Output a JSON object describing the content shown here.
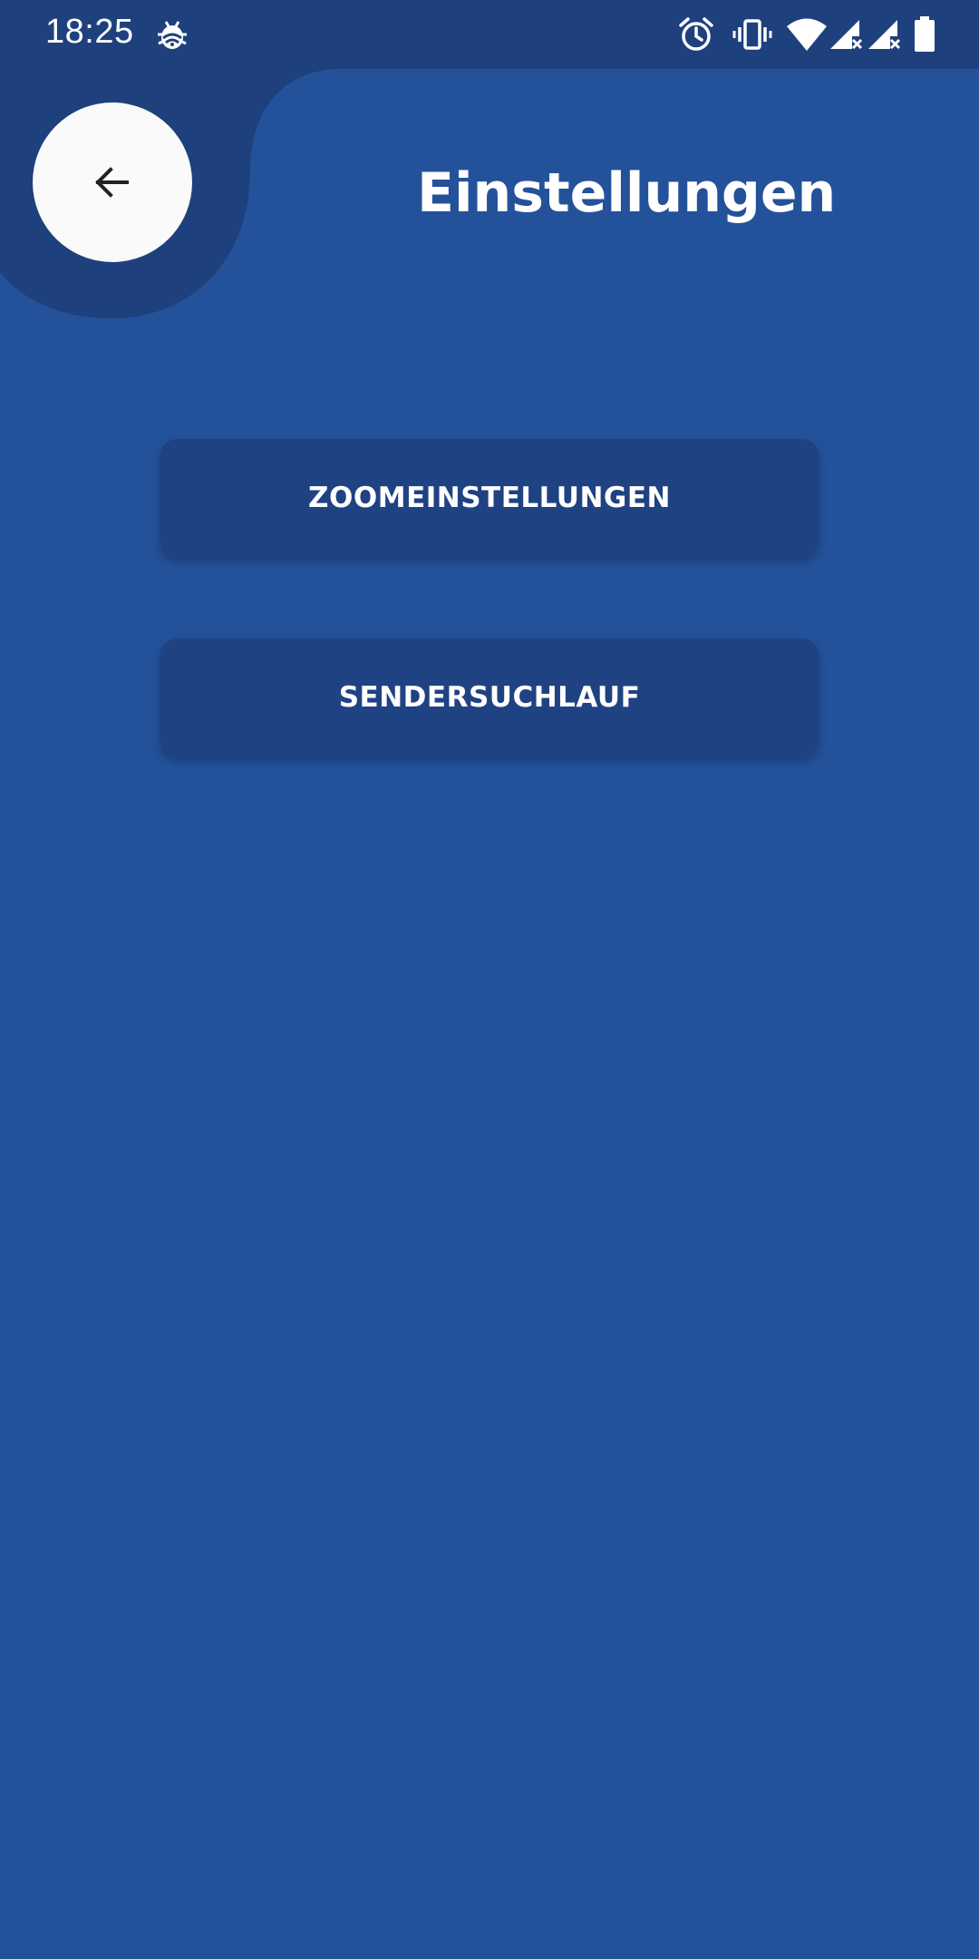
{
  "status_bar": {
    "time": "18:25",
    "icons": [
      "debug-bug-icon",
      "alarm-icon",
      "vibrate-icon",
      "wifi-icon",
      "signal-x-icon",
      "signal-x-icon",
      "battery-icon"
    ]
  },
  "header": {
    "title": "Einstellungen",
    "back_icon": "arrow-left-icon"
  },
  "menu": {
    "items": [
      {
        "label": "ZOOMEINSTELLUNGEN"
      },
      {
        "label": "SENDERSUCHLAUF"
      }
    ]
  },
  "colors": {
    "background": "#24529a",
    "status_bar": "#1e407d",
    "button": "#1f4283",
    "back_button": "#fafafa",
    "text": "#ffffff"
  }
}
